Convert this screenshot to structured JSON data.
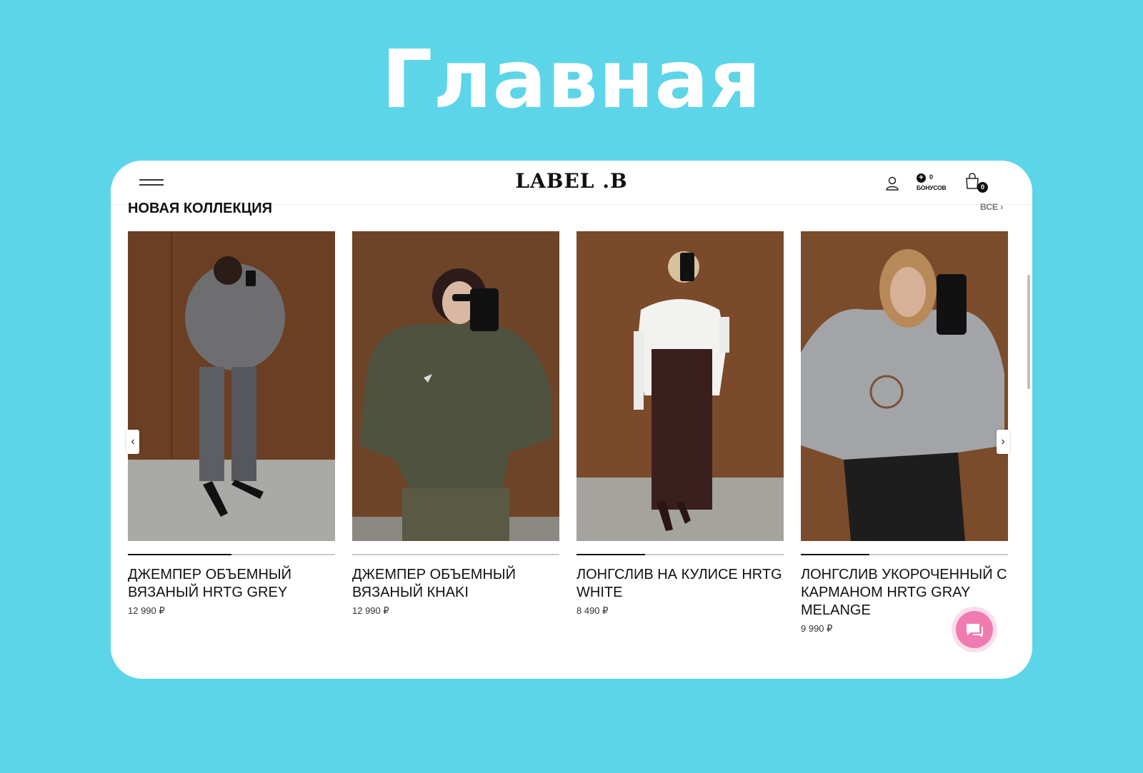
{
  "page_heading": "Главная",
  "header": {
    "logo": "LABEL .B",
    "bonus_count": "0",
    "bonus_label": "БОНУСОВ",
    "cart_count": "0"
  },
  "section": {
    "title": "НОВАЯ КОЛЛЕКЦИЯ",
    "see_all": "ВСЕ ›"
  },
  "products": [
    {
      "name": "ДЖЕМПЕР ОБЪЕМНЫЙ ВЯЗАНЫЙ HRTG GREY",
      "price": "12 990 ₽",
      "image_progress": 0.5
    },
    {
      "name": "ДЖЕМПЕР ОБЪЕМНЫЙ ВЯЗАНЫЙ КHAKI",
      "price": "12 990 ₽",
      "image_progress": 0.0
    },
    {
      "name": "ЛОНГСЛИВ НА КУЛИСЕ HRTG WHITE",
      "price": "8 490 ₽",
      "image_progress": 0.33
    },
    {
      "name": "ЛОНГСЛИВ УКОРОЧЕННЫЙ С КАРМАНОМ HRTG GRAY MELANGE",
      "price": "9 990 ₽",
      "image_progress": 0.33
    }
  ],
  "colors": {
    "background": "#5dd5e8",
    "chat_button": "#f07bb0"
  }
}
